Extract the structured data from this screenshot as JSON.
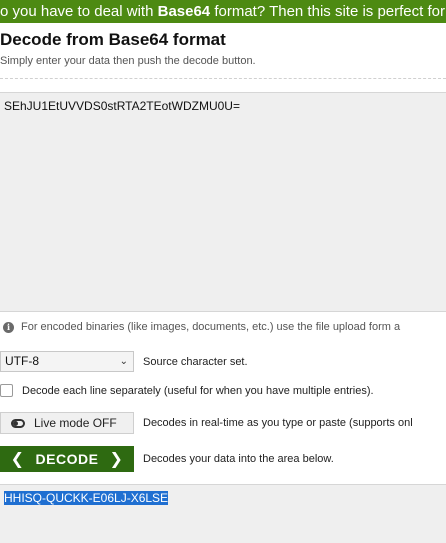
{
  "banner": {
    "pre": "o you have to deal with ",
    "bold": "Base64",
    "post": " format? Then this site is perfect for you!"
  },
  "header": {
    "title": "Decode from Base64 format",
    "subtitle": "Simply enter your data then push the decode button."
  },
  "input": {
    "value": "SEhJU1EtUVVDS0stRTA2TEotWDZMU0U="
  },
  "info": {
    "text": "For encoded binaries (like images, documents, etc.) use the file upload form a"
  },
  "charset": {
    "selected": "UTF-8",
    "label": "Source character set."
  },
  "lines": {
    "label": "Decode each line separately (useful for when you have multiple entries)."
  },
  "live": {
    "button_label": "Live mode OFF",
    "label": "Decodes in real-time as you type or paste (supports onl"
  },
  "decode": {
    "button_label": "DECODE",
    "label": "Decodes your data into the area below."
  },
  "output": {
    "value": "HHISQ-QUCKK-E06LJ-X6LSE"
  },
  "colors": {
    "banner": "#4d8a12",
    "decode_button": "#2e6a11",
    "selection": "#1f6fd1"
  }
}
